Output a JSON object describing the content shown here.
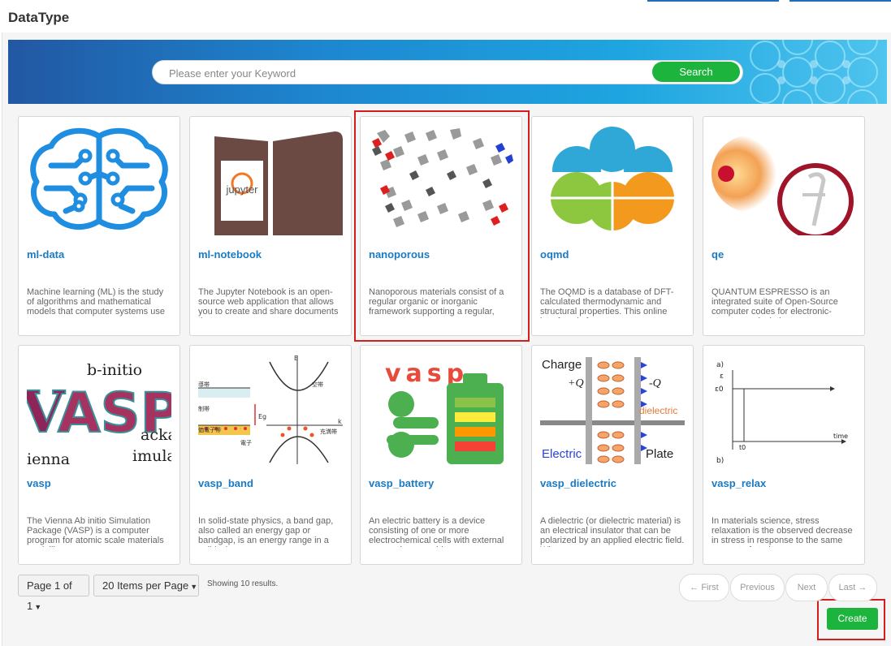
{
  "page": {
    "title": "DataType"
  },
  "search": {
    "placeholder": "Please enter your Keyword",
    "button_label": "Search"
  },
  "cards": [
    {
      "title": "ml-data",
      "desc": "Machine learning (ML) is the study of algorithms and mathematical models that computer systems use to progr..."
    },
    {
      "title": "ml-notebook",
      "desc": "The Jupyter Notebook is an open-source web application that allows you to create and share documents that co..."
    },
    {
      "title": "nanoporous",
      "desc": "Nanoporous materials consist of a regular organic or inorganic framework supporting a regular, porous structur..."
    },
    {
      "title": "oqmd",
      "desc": "The OQMD is a database of DFT-calculated thermodynamic and structural properties. This online interface is fo..."
    },
    {
      "title": "qe",
      "desc": "QUANTUM ESPRESSO is an integrated suite of Open-Source computer codes for electronic-structure calculatio..."
    },
    {
      "title": "vasp",
      "desc": "The Vienna Ab initio Simulation Package (VASP) is a computer program for atomic scale materials modelling, e...."
    },
    {
      "title": "vasp_band",
      "desc": "In solid-state physics, a band gap, also called an energy gap or bandgap, is an energy range in a solid where no ..."
    },
    {
      "title": "vasp_battery",
      "desc": "An electric battery is a device consisting of one or more electrochemical cells with external connections provide..."
    },
    {
      "title": "vasp_dielectric",
      "desc": "A dielectric (or dielectric material) is an electrical insulator that can be polarized by an applied electric field. Whe..."
    },
    {
      "title": "vasp_relax",
      "desc": "In materials science, stress relaxation is the observed decrease in stress in response to the same amount of strain..."
    }
  ],
  "thumbs": {
    "jupyter": "jupyter",
    "vasp_logo": {
      "b_initio": "b-initio",
      "asp": "ASP",
      "v": "V",
      "acka": "acka",
      "imula": "imula",
      "ienna": "ienna"
    },
    "band": {
      "e": "E",
      "k": "k",
      "eg": "Eg",
      "top_band": "導帯",
      "mid_band": "制帯",
      "low_band": "価電子帯",
      "empty_band": "空帯",
      "electron": "電子",
      "filled_band": "充満帯"
    },
    "battery": {
      "word": "vasp"
    },
    "dielectric": {
      "charge": "Charge",
      "plus_q": "+Q",
      "minus_q": "-Q",
      "dielectric": "dielectric",
      "electric": "Electric",
      "plate": "Plate"
    },
    "relax": {
      "a": "a)",
      "eps": "ε",
      "eps0": "ε0",
      "t0": "t0",
      "time": "time",
      "b": "b)"
    }
  },
  "pager": {
    "page_label": "Page 1 of 1",
    "per_page_label": "20 Items per Page",
    "showing": "Showing 10 results.",
    "first": "← First",
    "previous": "Previous",
    "next": "Next",
    "last": "Last →"
  },
  "create_label": "Create",
  "colors": {
    "brand_green": "#1cb43c",
    "link_blue": "#1a7bc4",
    "highlight_red": "#d21e1e",
    "banner_blue": "#1d86cf"
  }
}
